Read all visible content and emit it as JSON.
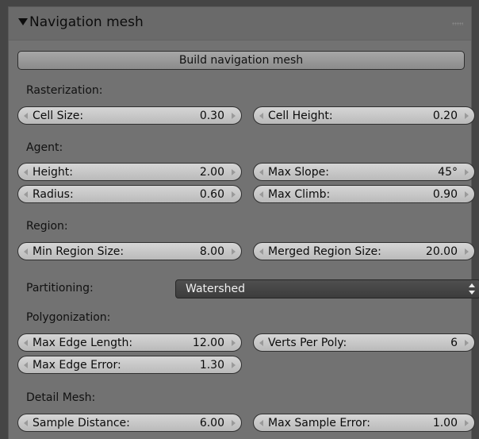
{
  "panel": {
    "title": "Navigation mesh",
    "build_button": "Build navigation mesh"
  },
  "sections": {
    "rasterization": "Rasterization:",
    "agent": "Agent:",
    "region": "Region:",
    "polygonization": "Polygonization:",
    "detail_mesh": "Detail Mesh:"
  },
  "fields": {
    "cell_size": {
      "label": "Cell Size:",
      "value": "0.30"
    },
    "cell_height": {
      "label": "Cell Height:",
      "value": "0.20"
    },
    "height": {
      "label": "Height:",
      "value": "2.00"
    },
    "max_slope": {
      "label": "Max Slope:",
      "value": "45°"
    },
    "radius": {
      "label": "Radius:",
      "value": "0.60"
    },
    "max_climb": {
      "label": "Max Climb:",
      "value": "0.90"
    },
    "min_region_size": {
      "label": "Min Region Size:",
      "value": "8.00"
    },
    "merged_region_size": {
      "label": "Merged Region Size:",
      "value": "20.00"
    },
    "max_edge_length": {
      "label": "Max Edge Length:",
      "value": "12.00"
    },
    "verts_per_poly": {
      "label": "Verts Per Poly:",
      "value": "6"
    },
    "max_edge_error": {
      "label": "Max Edge Error:",
      "value": "1.30"
    },
    "sample_distance": {
      "label": "Sample Distance:",
      "value": "6.00"
    },
    "max_sample_error": {
      "label": "Max Sample Error:",
      "value": "1.00"
    }
  },
  "partitioning": {
    "label": "Partitioning:",
    "value": "Watershed"
  },
  "icons": {
    "collapse": "triangle-down-icon",
    "grip": "drag-grip-icon",
    "decrement": "arrow-left-icon",
    "increment": "arrow-right-icon",
    "dropdown": "updown-arrows-icon"
  },
  "colors": {
    "panel_bg": "#727272",
    "field_bg": "#c8c8c8",
    "dropdown_bg": "#454545"
  }
}
